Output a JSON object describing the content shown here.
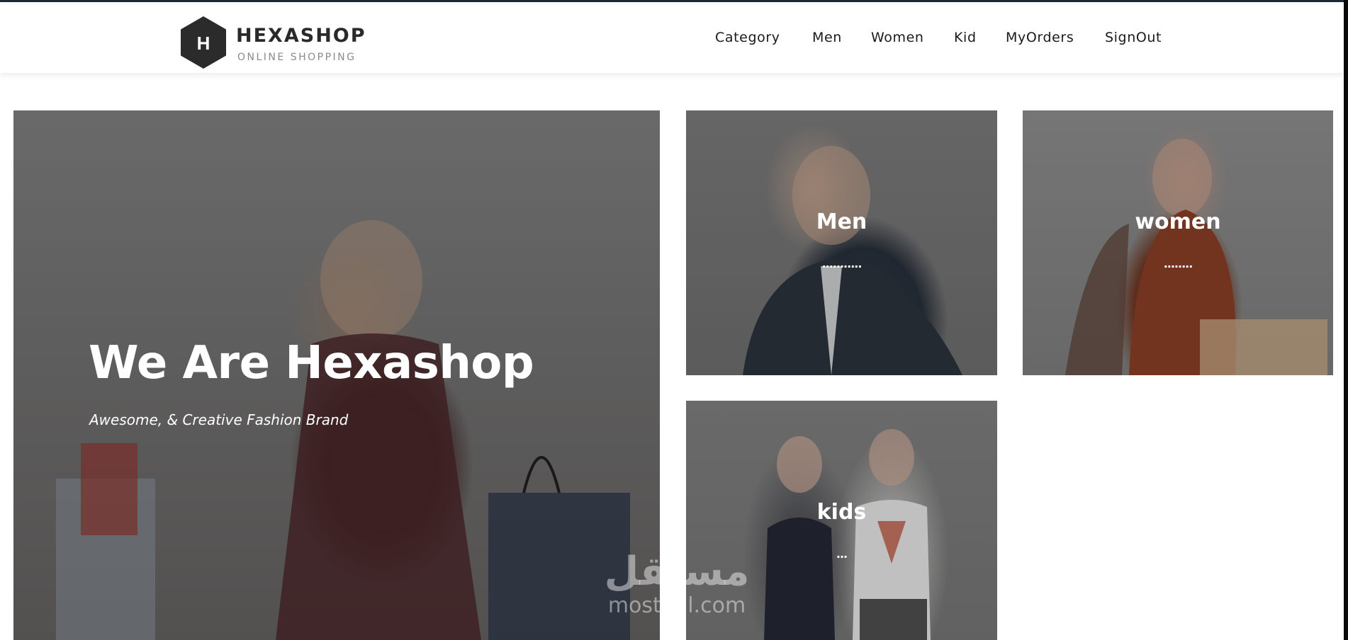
{
  "header": {
    "logo_letter": "H",
    "brand": "HEXASHOP",
    "tagline": "ONLINE SHOPPING",
    "nav": [
      "Category",
      "Men",
      "Women",
      "Kid",
      "MyOrders",
      "SignOut"
    ]
  },
  "hero": {
    "title": "We Are Hexashop",
    "subtitle": "Awesome, & Creative Fashion Brand"
  },
  "cards": {
    "men": {
      "title": "Men",
      "dots": "..........."
    },
    "women": {
      "title": "women",
      "dots": "........"
    },
    "kids": {
      "title": "kids",
      "dots": "..."
    }
  },
  "watermark": {
    "arabic": "مستقل",
    "latin": "mostaql.com"
  },
  "colors": {
    "accent": "#2a2a2a",
    "overlay": "#3b3b3b",
    "text_on_image": "#ffffff"
  }
}
